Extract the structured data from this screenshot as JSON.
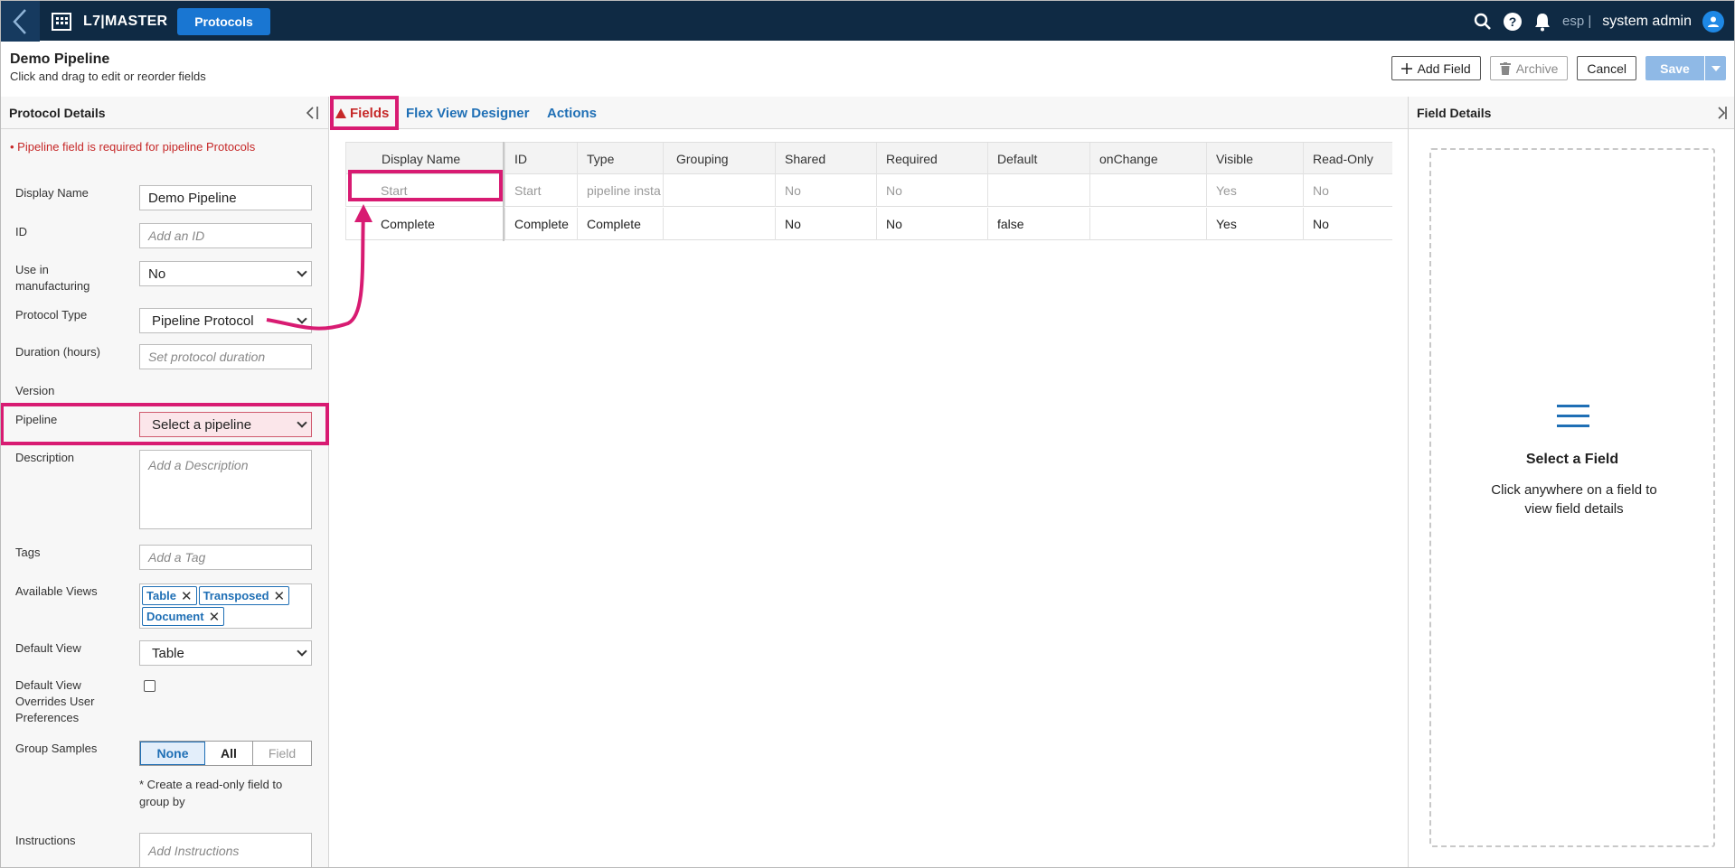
{
  "topbar": {
    "brand": "L7|MASTER",
    "app_pill": "Protocols",
    "lang": "esp |",
    "user": "system admin"
  },
  "header": {
    "title": "Demo Pipeline",
    "subtitle": "Click and drag to edit or reorder fields",
    "add_field": "Add Field",
    "archive": "Archive",
    "cancel": "Cancel",
    "save": "Save"
  },
  "left_panel": {
    "title": "Protocol Details",
    "error": "• Pipeline field is required for pipeline Protocols",
    "fields": {
      "display_name": {
        "label": "Display Name",
        "value": "Demo Pipeline"
      },
      "id": {
        "label": "ID",
        "placeholder": "Add an ID"
      },
      "use_in_manufacturing": {
        "label": "Use in manufacturing",
        "value": "No"
      },
      "protocol_type": {
        "label": "Protocol Type",
        "value": "Pipeline Protocol"
      },
      "duration": {
        "label": "Duration (hours)",
        "placeholder": "Set protocol duration"
      },
      "version": {
        "label": "Version"
      },
      "pipeline": {
        "label": "Pipeline",
        "value": "Select a pipeline"
      },
      "description": {
        "label": "Description",
        "placeholder": "Add a Description"
      },
      "tags": {
        "label": "Tags",
        "placeholder": "Add a Tag"
      },
      "available_views": {
        "label": "Available Views",
        "chips": [
          "Table",
          "Transposed",
          "Document"
        ]
      },
      "default_view": {
        "label": "Default View",
        "value": "Table"
      },
      "default_override": {
        "label": "Default View Overrides User Preferences"
      },
      "group_samples": {
        "label": "Group Samples",
        "options": [
          "None",
          "All",
          "Field"
        ],
        "note": "* Create a read-only field to group by"
      },
      "instructions": {
        "label": "Instructions",
        "placeholder": "Add Instructions"
      }
    }
  },
  "tabs": [
    "Fields",
    "Flex View Designer",
    "Actions"
  ],
  "grid": {
    "columns": [
      "Display Name",
      "ID",
      "Type",
      "Grouping",
      "Shared",
      "Required",
      "Default",
      "onChange",
      "Visible",
      "Read-Only"
    ],
    "rows": [
      [
        "Start",
        "Start",
        "pipeline insta",
        "",
        "No",
        "No",
        "",
        "",
        "Yes",
        "No"
      ],
      [
        "Complete",
        "Complete",
        "Complete",
        "",
        "No",
        "No",
        "false",
        "",
        "Yes",
        "No"
      ]
    ]
  },
  "right_panel": {
    "title": "Field Details",
    "empty_title": "Select a Field",
    "empty_body": "Click anywhere on a field to view field details"
  },
  "colors": {
    "topbar": "#0f2a44",
    "accent": "#1f6fb5",
    "highlight": "#d81b72",
    "error": "#c62828"
  }
}
